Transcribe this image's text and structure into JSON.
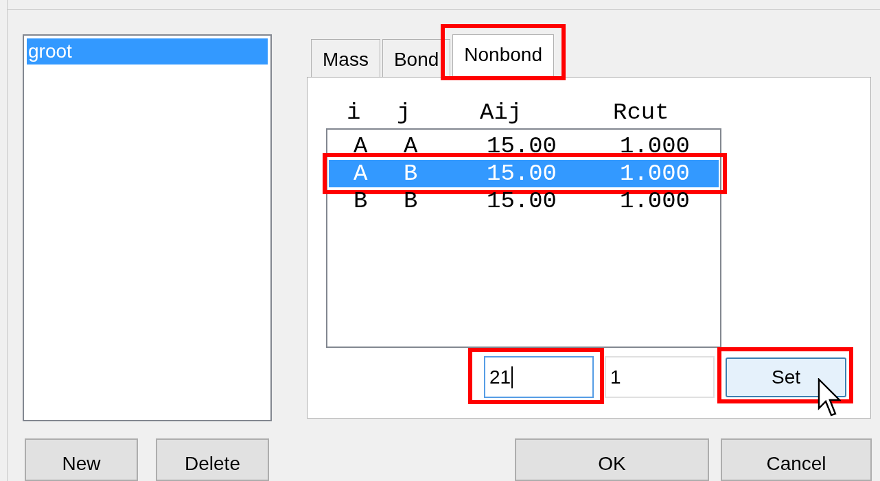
{
  "list": {
    "items": [
      {
        "label": "groot",
        "selected": true
      }
    ]
  },
  "tabs": [
    {
      "label": "Mass",
      "selected": false,
      "highlighted": false
    },
    {
      "label": "Bond",
      "selected": false,
      "highlighted": false
    },
    {
      "label": "Nonbond",
      "selected": true,
      "highlighted": true
    }
  ],
  "table": {
    "columns": [
      "i",
      "j",
      "Aij",
      "Rcut"
    ],
    "rows": [
      {
        "cells": [
          "A",
          "A",
          "15.00",
          "1.000"
        ],
        "selected": false,
        "highlighted": false
      },
      {
        "cells": [
          "A",
          "B",
          "15.00",
          "1.000"
        ],
        "selected": true,
        "highlighted": true
      },
      {
        "cells": [
          "B",
          "B",
          "15.00",
          "1.000"
        ],
        "selected": false,
        "highlighted": false
      }
    ]
  },
  "fields": [
    {
      "value": "21",
      "focused": true,
      "highlighted": true
    },
    {
      "value": "1",
      "focused": false,
      "highlighted": false
    }
  ],
  "set_button": {
    "label": "Set",
    "hovered": true,
    "highlighted": true
  },
  "buttons_left": [
    "New",
    "Delete"
  ],
  "buttons_right": [
    "OK",
    "Cancel"
  ]
}
